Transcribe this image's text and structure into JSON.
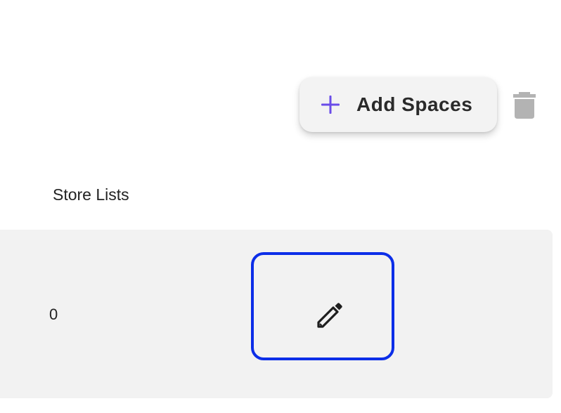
{
  "toolbar": {
    "add_spaces_label": "Add Spaces",
    "add_icon": "plus-icon",
    "delete_icon": "trash-icon"
  },
  "section": {
    "title": "Store Lists"
  },
  "list": {
    "rows": [
      {
        "index": "0",
        "action_icon": "pencil-icon"
      }
    ]
  },
  "colors": {
    "accent": "#6a4ce8",
    "focus_ring": "#0c2ee8",
    "icon_gray": "#b3b3b3",
    "row_background": "#f2f2f2",
    "button_background": "#f3f3f3"
  }
}
